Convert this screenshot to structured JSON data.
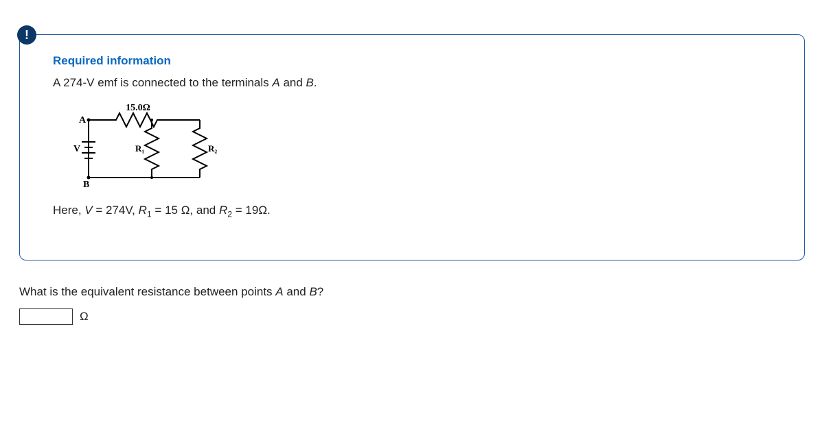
{
  "badge": "!",
  "title": "Required information",
  "body_prefix": "A 274-V emf is connected to the terminals ",
  "body_a": "A",
  "body_and": " and ",
  "body_b": "B",
  "body_suffix": ".",
  "diagram": {
    "top_label": "15.0Ω",
    "A": "A",
    "B": "B",
    "V": "V",
    "R1": "R₁",
    "R2": "R₂"
  },
  "given_prefix": "Here, ",
  "given_V": "V",
  "given_V_eq": " = 274V, ",
  "given_R1": "R",
  "given_R1_sub": "1",
  "given_R1_eq": " = 15 Ω, and ",
  "given_R2": "R",
  "given_R2_sub": "2",
  "given_R2_eq": " = 19Ω.",
  "question_prefix": "What is the equivalent resistance between points ",
  "question_a": "A",
  "question_and": " and ",
  "question_b": "B",
  "question_suffix": "?",
  "answer_value": "",
  "unit": "Ω"
}
